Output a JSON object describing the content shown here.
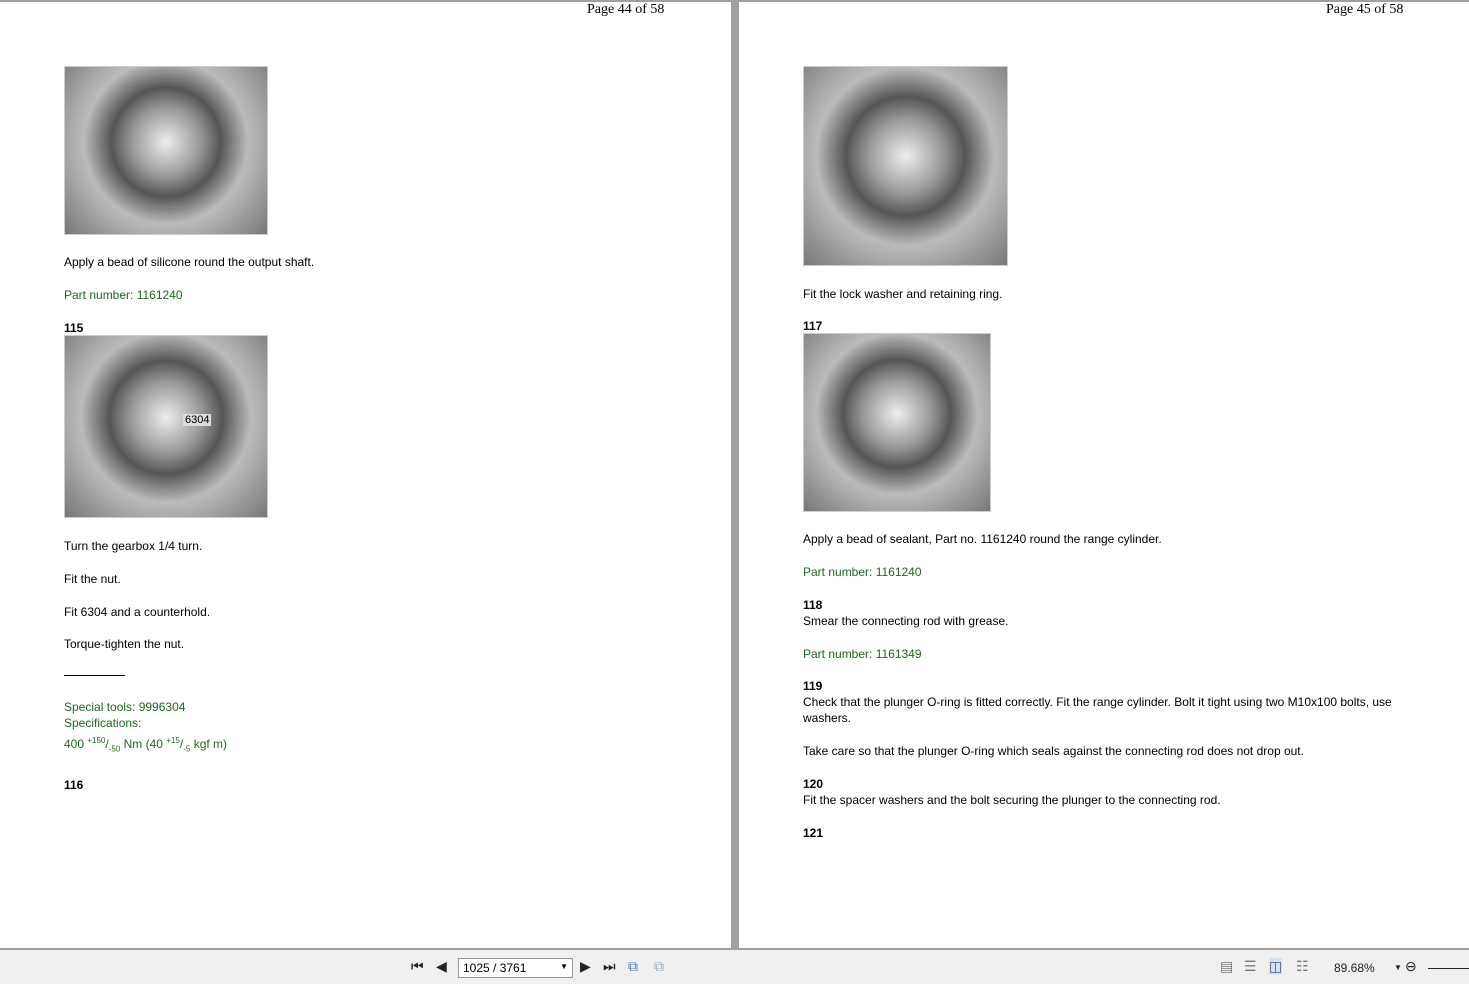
{
  "left_page": {
    "header": "Page 44 of 58",
    "caption1": "Apply a bead of silicone round the output shaft.",
    "part1": "Part number: 1161240",
    "step115": "115",
    "photo_label": "6304",
    "lines": [
      "Turn the gearbox 1/4 turn.",
      "Fit the nut.",
      "Fit 6304 and a counterhold.",
      "Torque-tighten the nut."
    ],
    "special_tools": "Special tools: 9996304",
    "specs_label": "Specifications:",
    "spec": {
      "a": "400 ",
      "a_sup": "+150",
      "a_sub": "-50",
      "b": " Nm (40 ",
      "b_sup": "+15",
      "b_sub": "-5",
      "c": " kgf m)"
    },
    "step116": "116"
  },
  "right_page": {
    "header": "Page 45 of 58",
    "caption1": "Fit the lock washer and retaining ring.",
    "step117": "117",
    "caption2": "Apply a bead of sealant, Part no. 1161240 round the range cylinder.",
    "part2": "Part number: 1161240",
    "step118": "118",
    "text118": "Smear the connecting rod with grease.",
    "part3": "Part number: 1161349",
    "step119": "119",
    "text119a": "Check that the plunger O-ring is fitted correctly. Fit the range cylinder. Bolt it tight using two M10x100 bolts, use",
    "text119b": "washers.",
    "text119c": "Take care so that the plunger O-ring which seals against the connecting rod does not drop out.",
    "step120": "120",
    "text120": "Fit the spacer washers and the bolt securing the plunger to the connecting rod.",
    "step121": "121"
  },
  "toolbar": {
    "page_value": "1025 / 3761",
    "zoom": "89.68%",
    "icons": [
      "first-page",
      "prev-page",
      "next-page",
      "last-page",
      "previous-view",
      "next-view",
      "single-page",
      "continuous",
      "facing",
      "continuous-facing",
      "zoom-out"
    ]
  }
}
